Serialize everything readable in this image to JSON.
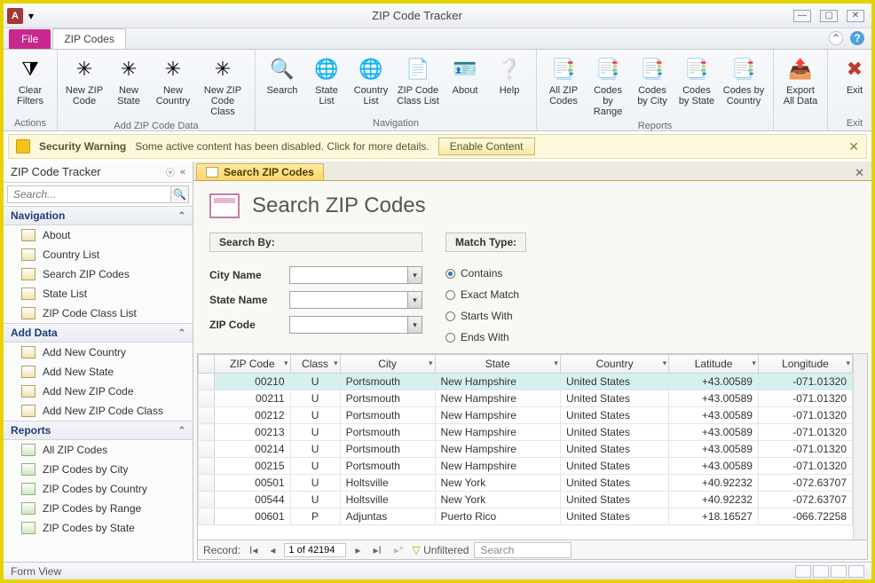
{
  "window": {
    "title": "ZIP Code Tracker"
  },
  "tabs": {
    "file": "File",
    "zip": "ZIP Codes"
  },
  "ribbon": {
    "groups": {
      "actions": {
        "label": "Actions",
        "clear_filters": "Clear\nFilters"
      },
      "add": {
        "label": "Add ZIP Code Data",
        "new_zip": "New ZIP\nCode",
        "new_state": "New\nState",
        "new_country": "New\nCountry",
        "new_class": "New ZIP\nCode Class"
      },
      "nav": {
        "label": "Navigation",
        "search": "Search",
        "state_list": "State\nList",
        "country_list": "Country\nList",
        "class_list": "ZIP Code\nClass List",
        "about": "About",
        "help": "Help"
      },
      "reports": {
        "label": "Reports",
        "all": "All ZIP\nCodes",
        "by_range": "Codes by\nRange",
        "by_city": "Codes\nby City",
        "by_state": "Codes\nby State",
        "by_country": "Codes by\nCountry"
      },
      "export": {
        "label": "",
        "export_all": "Export\nAll Data"
      },
      "exit": {
        "label": "Exit",
        "exit": "Exit"
      }
    }
  },
  "security": {
    "title": "Security Warning",
    "msg": "Some active content has been disabled. Click for more details.",
    "enable": "Enable Content"
  },
  "navpane": {
    "title": "ZIP Code Tracker",
    "search_ph": "Search...",
    "groups": [
      {
        "name": "Navigation",
        "items": [
          "About",
          "Country List",
          "Search ZIP Codes",
          "State List",
          "ZIP Code Class List"
        ]
      },
      {
        "name": "Add Data",
        "items": [
          "Add New Country",
          "Add New State",
          "Add New ZIP Code",
          "Add New ZIP Code Class"
        ]
      },
      {
        "name": "Reports",
        "items": [
          "All ZIP Codes",
          "ZIP Codes by City",
          "ZIP Codes by Country",
          "ZIP Codes by Range",
          "ZIP Codes by State"
        ]
      }
    ]
  },
  "doc": {
    "tab": "Search ZIP Codes",
    "heading": "Search ZIP Codes"
  },
  "search": {
    "by_label": "Search By:",
    "match_label": "Match Type:",
    "fields": {
      "city": "City Name",
      "state": "State Name",
      "zip": "ZIP Code"
    },
    "match": {
      "contains": "Contains",
      "exact": "Exact Match",
      "starts": "Starts With",
      "ends": "Ends With"
    }
  },
  "grid": {
    "columns": [
      "ZIP Code",
      "Class",
      "City",
      "State",
      "Country",
      "Latitude",
      "Longitude"
    ],
    "rows": [
      [
        "00210",
        "U",
        "Portsmouth",
        "New Hampshire",
        "United States",
        "+43.00589",
        "-071.01320"
      ],
      [
        "00211",
        "U",
        "Portsmouth",
        "New Hampshire",
        "United States",
        "+43.00589",
        "-071.01320"
      ],
      [
        "00212",
        "U",
        "Portsmouth",
        "New Hampshire",
        "United States",
        "+43.00589",
        "-071.01320"
      ],
      [
        "00213",
        "U",
        "Portsmouth",
        "New Hampshire",
        "United States",
        "+43.00589",
        "-071.01320"
      ],
      [
        "00214",
        "U",
        "Portsmouth",
        "New Hampshire",
        "United States",
        "+43.00589",
        "-071.01320"
      ],
      [
        "00215",
        "U",
        "Portsmouth",
        "New Hampshire",
        "United States",
        "+43.00589",
        "-071.01320"
      ],
      [
        "00501",
        "U",
        "Holtsville",
        "New York",
        "United States",
        "+40.92232",
        "-072.63707"
      ],
      [
        "00544",
        "U",
        "Holtsville",
        "New York",
        "United States",
        "+40.92232",
        "-072.63707"
      ],
      [
        "00601",
        "P",
        "Adjuntas",
        "Puerto Rico",
        "United States",
        "+18.16527",
        "-066.72258"
      ]
    ]
  },
  "recnav": {
    "label": "Record:",
    "pos": "1 of 42194",
    "unfiltered": "Unfiltered",
    "search": "Search"
  },
  "status": {
    "view": "Form View"
  }
}
